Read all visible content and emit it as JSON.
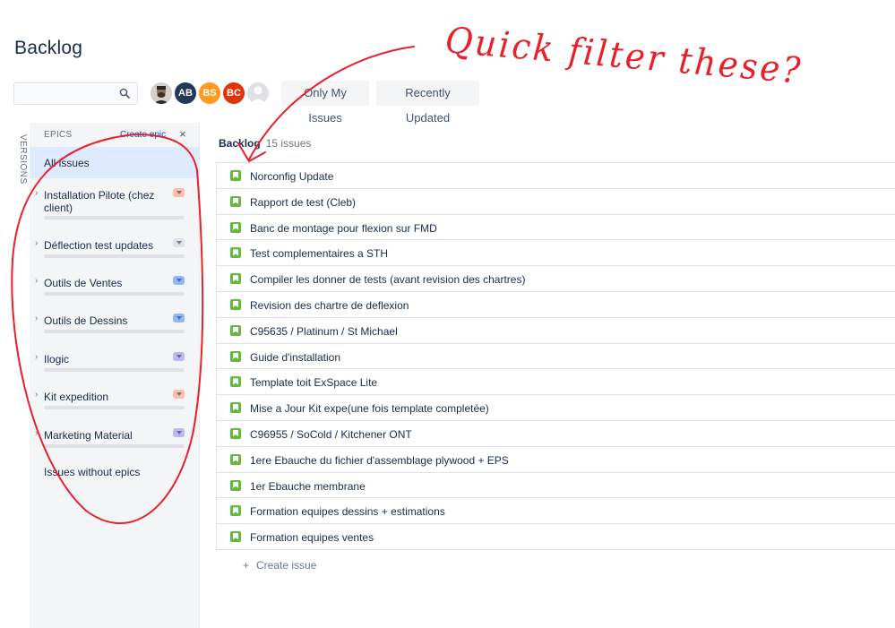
{
  "page": {
    "title": "Backlog"
  },
  "search": {
    "value": "",
    "placeholder": ""
  },
  "avatars": [
    {
      "initials": ""
    },
    {
      "initials": "AB"
    },
    {
      "initials": "BS"
    },
    {
      "initials": "BC"
    },
    {
      "initials": ""
    }
  ],
  "quick_filters": {
    "only_my_issues": "Only My Issues",
    "recently_updated": "Recently Updated"
  },
  "versions_tab": "VERSIONS",
  "epics_panel": {
    "title": "EPICS",
    "create_epic": "Create epic",
    "close": "×",
    "all_issues": "All issues",
    "items": [
      {
        "name": "Installation Pilote (chez client)",
        "color": "#ffbdad"
      },
      {
        "name": "Déflection test updates",
        "color": "#dfe1e6"
      },
      {
        "name": "Outils de Ventes",
        "color": "#8fb8f6"
      },
      {
        "name": "Outils de Dessins",
        "color": "#8fb8f6"
      },
      {
        "name": "Ilogic",
        "color": "#c0b6f2"
      },
      {
        "name": "Kit expedition",
        "color": "#ffbdad"
      },
      {
        "name": "Marketing Material",
        "color": "#c0b6f2"
      }
    ],
    "issues_without_epics": "Issues without epics"
  },
  "backlog": {
    "label": "Backlog",
    "count": "15 issues",
    "issues": [
      "Norconfig Update",
      "Rapport de test (Cleb)",
      "Banc de montage pour flexion sur FMD",
      "Test complementaires a STH",
      "Compiler les donner de tests (avant revision des chartres)",
      "Revision des chartre de deflexion",
      "C95635 / Platinum / St Michael",
      "Guide d'installation",
      "Template toit ExSpace Lite",
      "Mise a Jour Kit expe(une fois template completée)",
      "C96955 / SoCold / Kitchener ONT",
      "1ere Ebauche du fichier d'assemblage plywood + EPS",
      "1er Ebauche membrane",
      "Formation equipes dessins + estimations",
      "Formation equipes ventes"
    ],
    "create_issue": "Create issue"
  },
  "annotation": {
    "text": "Quick filter these?",
    "color": "#e8202a"
  }
}
